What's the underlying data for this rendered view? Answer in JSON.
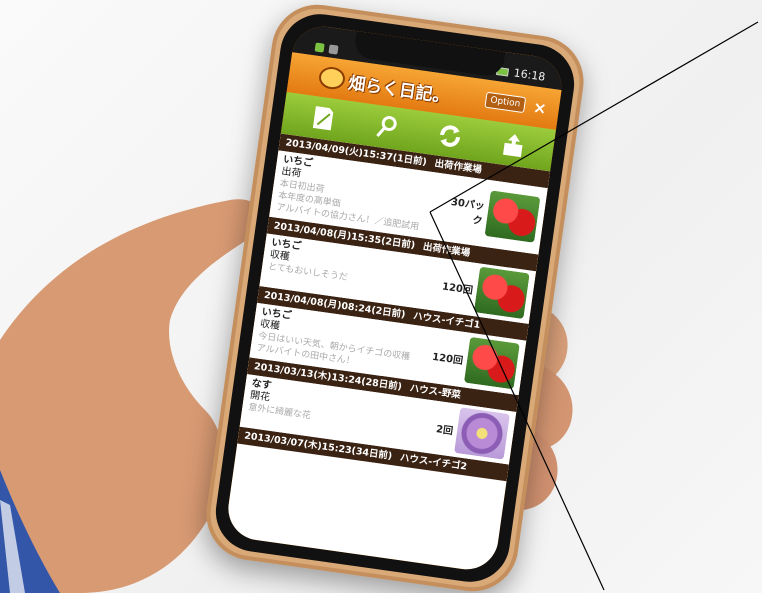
{
  "status_bar": {
    "time": "16:18"
  },
  "header": {
    "app_title": "畑らく日記。",
    "option_label": "Option",
    "close_label": "×"
  },
  "toolbar": {
    "icons": [
      "new-entry-icon",
      "search-icon",
      "refresh-icon",
      "upload-icon"
    ]
  },
  "entries": [
    {
      "date": "2013/04/09(火)15:37(1日前)",
      "location": "出荷作業場",
      "crop": "いちご",
      "work": "出荷",
      "memo_lines": [
        "本日初出荷",
        "本年度の高単価",
        "アルバイトの協力さん！／追肥試用"
      ],
      "quantity": "30パック",
      "thumb": "strawberry"
    },
    {
      "date": "2013/04/08(月)15:35(2日前)",
      "location": "出荷作業場",
      "crop": "いちご",
      "work": "収穫",
      "memo_lines": [
        "とてもおいしそうだ"
      ],
      "quantity": "120回",
      "thumb": "strawberry"
    },
    {
      "date": "2013/04/08(月)08:24(2日前)",
      "location": "ハウス-イチゴ1",
      "crop": "いちご",
      "work": "収穫",
      "memo_lines": [
        "今日はいい天気、朝からイチゴの収穫",
        "アルバイトの田中さん！"
      ],
      "quantity": "120回",
      "thumb": "strawberry"
    },
    {
      "date": "2013/03/13(木)13:24(28日前)",
      "location": "ハウス-野菜",
      "crop": "なす",
      "work": "開花",
      "memo_lines": [
        "意外に綺麗な花"
      ],
      "quantity": "2回",
      "thumb": "flower"
    },
    {
      "date": "2013/03/07(木)15:23(34日前)",
      "location": "ハウス-イチゴ2",
      "crop": "",
      "work": "",
      "memo_lines": [],
      "quantity": "",
      "thumb": ""
    }
  ],
  "colors": {
    "header": "#f28b1c",
    "toolbar": "#7cb82f",
    "entry_bar": "#3b2314"
  }
}
